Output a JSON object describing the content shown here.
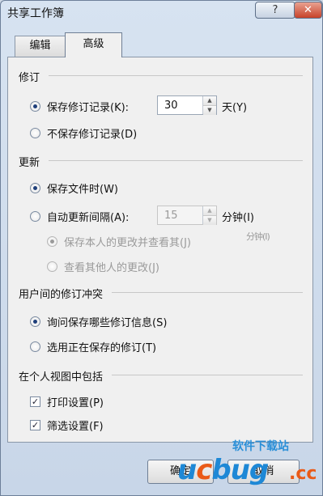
{
  "window": {
    "title": "共享工作簿"
  },
  "titlebar": {
    "help_label": "?",
    "close_label": "✕"
  },
  "tabs": [
    {
      "label": "编辑"
    },
    {
      "label": "高级"
    }
  ],
  "groups": {
    "revisions": {
      "title": "修订",
      "keep_history": {
        "label": "保存修订记录(K):",
        "value": "30",
        "unit": "天(Y)"
      },
      "dont_keep": {
        "label": "不保存修订记录(D)"
      }
    },
    "update": {
      "title": "更新",
      "when_saved": {
        "label": "保存文件时(W)"
      },
      "auto_every": {
        "label": "自动更新间隔(A):",
        "value": "15",
        "unit": "分钟(I)"
      },
      "save_mine": {
        "label": "保存本人的更改并查看其(J)",
        "trailing": "分钟(I)"
      },
      "just_see": {
        "label": "查看其他人的更改(J)"
      }
    },
    "conflicts": {
      "title": "用户间的修订冲突",
      "ask": {
        "label": "询问保存哪些修订信息(S)"
      },
      "saving_wins": {
        "label": "选用正在保存的修订(T)"
      }
    },
    "personal_view": {
      "title": "在个人视图中包括",
      "print": {
        "label": "打印设置(P)"
      },
      "filter": {
        "label": "筛选设置(F)"
      }
    }
  },
  "buttons": {
    "ok": "确定",
    "cancel": "取消"
  },
  "watermark": {
    "small": "软件下载站",
    "brand_u": "u",
    "brand_c": "c",
    "brand_rest": "bug",
    "brand_cc": ".cc"
  }
}
